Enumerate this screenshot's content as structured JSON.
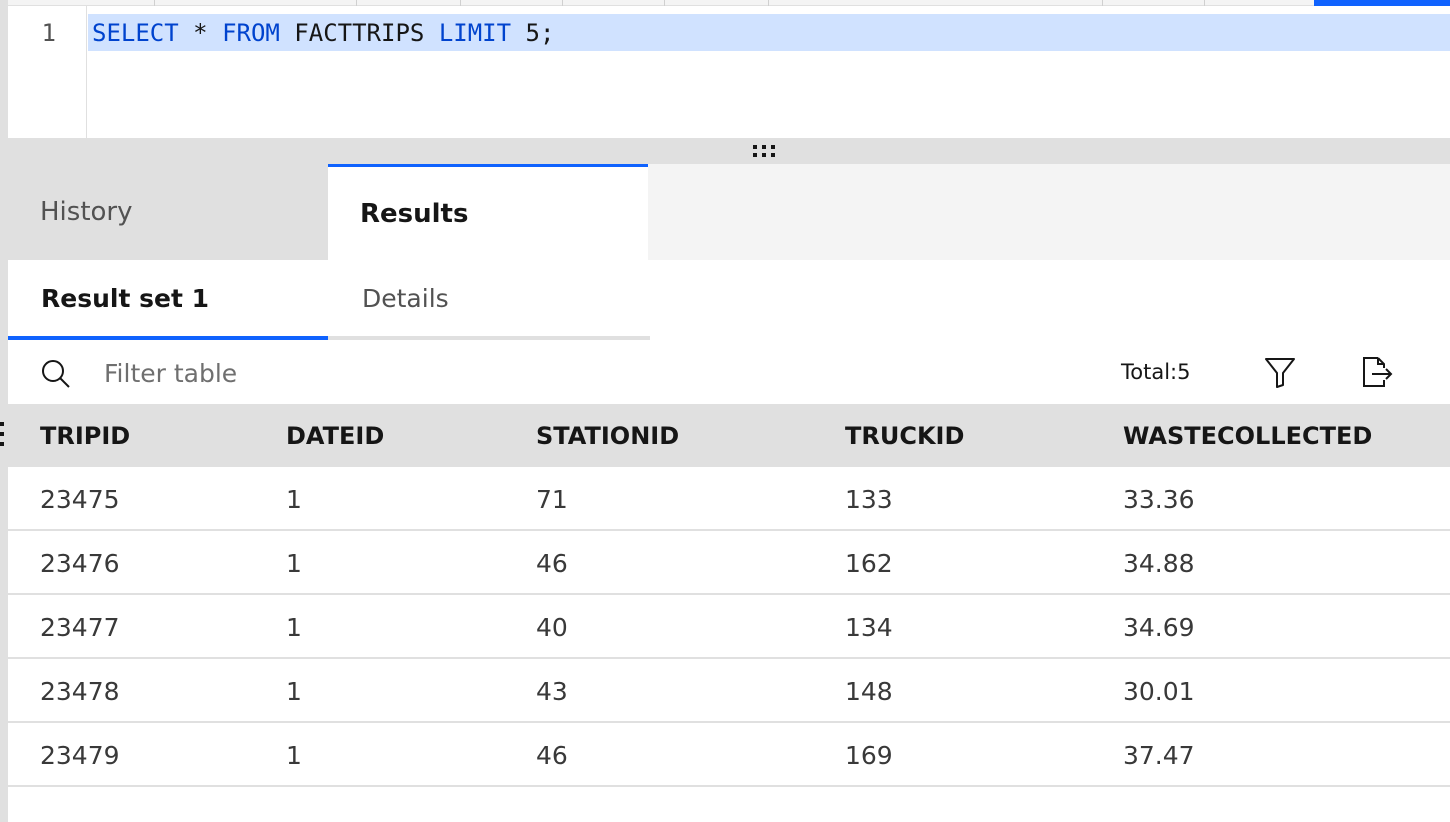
{
  "editor": {
    "line_number": "1",
    "code_tokens": [
      {
        "text": "SELECT",
        "kind": "keyword"
      },
      {
        "text": " * ",
        "kind": "plain"
      },
      {
        "text": "FROM",
        "kind": "keyword"
      },
      {
        "text": " FACTTRIPS ",
        "kind": "plain"
      },
      {
        "text": "LIMIT",
        "kind": "keyword"
      },
      {
        "text": " 5;",
        "kind": "plain"
      }
    ]
  },
  "tabs": {
    "history_label": "History",
    "results_label": "Results",
    "active": "Results"
  },
  "subtabs": {
    "result_set_label": "Result set 1",
    "details_label": "Details",
    "active": "Result set 1"
  },
  "toolbar": {
    "filter_placeholder": "Filter table",
    "total_label": "Total:5",
    "icons": [
      "search-icon",
      "filter-icon",
      "export-icon"
    ]
  },
  "table": {
    "columns": [
      "TRIPID",
      "DATEID",
      "STATIONID",
      "TRUCKID",
      "WASTECOLLECTED"
    ],
    "rows": [
      [
        "23475",
        "1",
        "71",
        "133",
        "33.36"
      ],
      [
        "23476",
        "1",
        "46",
        "162",
        "34.88"
      ],
      [
        "23477",
        "1",
        "40",
        "134",
        "34.69"
      ],
      [
        "23478",
        "1",
        "43",
        "148",
        "30.01"
      ],
      [
        "23479",
        "1",
        "46",
        "169",
        "37.47"
      ]
    ]
  },
  "colors": {
    "accent": "#0f62fe",
    "keyword": "#0043ce",
    "selection": "#d0e2ff"
  }
}
